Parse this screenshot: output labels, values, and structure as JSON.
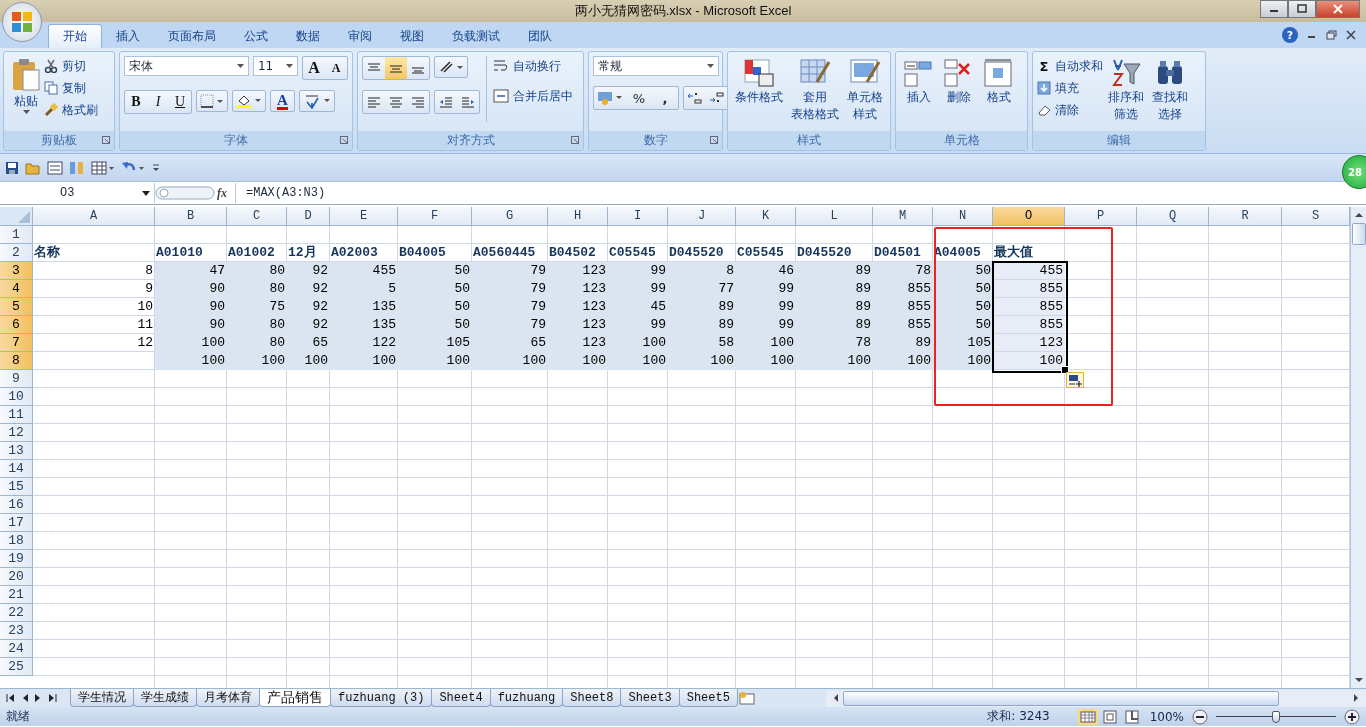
{
  "window": {
    "title": "两小无猜网密码.xlsx - Microsoft Excel"
  },
  "ribbon": {
    "tabs": [
      {
        "label": "开始",
        "selected": true
      },
      {
        "label": "插入",
        "selected": false
      },
      {
        "label": "页面布局",
        "selected": false
      },
      {
        "label": "公式",
        "selected": false
      },
      {
        "label": "数据",
        "selected": false
      },
      {
        "label": "审阅",
        "selected": false
      },
      {
        "label": "视图",
        "selected": false
      },
      {
        "label": "负载测试",
        "selected": false
      },
      {
        "label": "团队",
        "selected": false
      }
    ],
    "help": "?",
    "clipboard": {
      "paste": "粘贴",
      "cut": "剪切",
      "copy": "复制",
      "format_painter": "格式刷",
      "title": "剪贴板"
    },
    "font": {
      "name": "宋体",
      "size": "11",
      "grow": "A",
      "shrink": "A",
      "bold": "B",
      "italic": "I",
      "underline": "U",
      "font_color": "A",
      "title": "字体"
    },
    "alignment": {
      "wrap": "自动换行",
      "merge": "合并后居中",
      "title": "对齐方式"
    },
    "number": {
      "format": "常规",
      "percent": "%",
      "comma": ",",
      "title": "数字"
    },
    "styles": {
      "conditional": "条件格式",
      "table": [
        "套用",
        "表格格式"
      ],
      "cell": [
        "单元格",
        "样式"
      ],
      "title": "样式"
    },
    "cells": {
      "insert": "插入",
      "delete": "删除",
      "format": "格式",
      "title": "单元格"
    },
    "editing": {
      "autosum_icon": "Σ",
      "autosum": "自动求和",
      "fill": "填充",
      "clear": "清除",
      "sort": [
        "排序和",
        "筛选"
      ],
      "find": [
        "查找和",
        "选择"
      ],
      "title": "编辑"
    }
  },
  "badge": "28",
  "formula_bar": {
    "name_box": "O3",
    "function_icon": "fx",
    "formula": "=MAX(A3:N3)"
  },
  "grid": {
    "columns": [
      {
        "label": "A",
        "selected": false
      },
      {
        "label": "B",
        "selected": false,
        "shaded": true
      },
      {
        "label": "C",
        "selected": false,
        "shaded": true
      },
      {
        "label": "D",
        "selected": false,
        "shaded": true
      },
      {
        "label": "E",
        "selected": false,
        "shaded": true
      },
      {
        "label": "F",
        "selected": false,
        "shaded": true
      },
      {
        "label": "G",
        "selected": false,
        "shaded": true
      },
      {
        "label": "H",
        "selected": false,
        "shaded": true
      },
      {
        "label": "I",
        "selected": false,
        "shaded": true
      },
      {
        "label": "J",
        "selected": false,
        "shaded": true
      },
      {
        "label": "K",
        "selected": false,
        "shaded": true
      },
      {
        "label": "L",
        "selected": false,
        "shaded": true
      },
      {
        "label": "M",
        "selected": false,
        "shaded": true
      },
      {
        "label": "N",
        "selected": false,
        "shaded": true
      },
      {
        "label": "O",
        "selected": true
      },
      {
        "label": "P",
        "selected": false
      },
      {
        "label": "Q",
        "selected": false
      },
      {
        "label": "R",
        "selected": false
      },
      {
        "label": "S",
        "selected": false
      }
    ],
    "rows": [
      {
        "number": "1",
        "selected": false
      },
      {
        "number": "2",
        "selected": false,
        "kind": "header",
        "cells": [
          "名称",
          "A01010",
          "A01002",
          "12月",
          "A02003",
          "B04005",
          "A0560445",
          "B04502",
          "C05545",
          "D045520",
          "C05545",
          "D045520",
          "D04501",
          "A04005",
          "最大值"
        ]
      },
      {
        "number": "3",
        "selected": true,
        "shaded": true,
        "cells": [
          "8",
          "47",
          "80",
          "92",
          "455",
          "50",
          "79",
          "123",
          "99",
          "8",
          "46",
          "89",
          "78",
          "50",
          "455"
        ]
      },
      {
        "number": "4",
        "selected": true,
        "shaded": true,
        "cells": [
          "9",
          "90",
          "80",
          "92",
          "5",
          "50",
          "79",
          "123",
          "99",
          "77",
          "99",
          "89",
          "855",
          "50",
          "855"
        ]
      },
      {
        "number": "5",
        "selected": true,
        "shaded": true,
        "cells": [
          "10",
          "90",
          "75",
          "92",
          "135",
          "50",
          "79",
          "123",
          "45",
          "89",
          "99",
          "89",
          "855",
          "50",
          "855"
        ]
      },
      {
        "number": "6",
        "selected": true,
        "shaded": true,
        "cells": [
          "11",
          "90",
          "80",
          "92",
          "135",
          "50",
          "79",
          "123",
          "99",
          "89",
          "99",
          "89",
          "855",
          "50",
          "855"
        ]
      },
      {
        "number": "7",
        "selected": true,
        "shaded": true,
        "cells": [
          "12",
          "100",
          "80",
          "65",
          "122",
          "105",
          "65",
          "123",
          "100",
          "58",
          "100",
          "78",
          "89",
          "105",
          "123"
        ]
      },
      {
        "number": "8",
        "selected": true,
        "shaded": true,
        "cells": [
          null,
          "100",
          "100",
          "100",
          "100",
          "100",
          "100",
          "100",
          "100",
          "100",
          "100",
          "100",
          "100",
          "100",
          "100"
        ]
      },
      {
        "number": "9",
        "selected": false
      },
      {
        "number": "10",
        "selected": false
      },
      {
        "number": "11",
        "selected": false
      },
      {
        "number": "12",
        "selected": false
      },
      {
        "number": "13",
        "selected": false
      },
      {
        "number": "14",
        "selected": false
      },
      {
        "number": "15",
        "selected": false
      },
      {
        "number": "16",
        "selected": false
      },
      {
        "number": "17",
        "selected": false
      },
      {
        "number": "18",
        "selected": false
      },
      {
        "number": "19",
        "selected": false
      },
      {
        "number": "20",
        "selected": false
      },
      {
        "number": "21",
        "selected": false
      },
      {
        "number": "22",
        "selected": false
      },
      {
        "number": "23",
        "selected": false
      },
      {
        "number": "24",
        "selected": false
      },
      {
        "number": "25",
        "selected": false
      }
    ],
    "annotation": {
      "kind": "rectangle"
    }
  },
  "sheet_tabs": [
    {
      "label": "学生情况",
      "selected": false
    },
    {
      "label": "学生成绩",
      "selected": false
    },
    {
      "label": "月考体育",
      "selected": false
    },
    {
      "label": "产品销售",
      "selected": true
    },
    {
      "label": "fuzhuang (3)",
      "selected": false
    },
    {
      "label": "Sheet4",
      "selected": false
    },
    {
      "label": "fuzhuang",
      "selected": false
    },
    {
      "label": "Sheet8",
      "selected": false
    },
    {
      "label": "Sheet3",
      "selected": false
    },
    {
      "label": "Sheet5",
      "selected": false
    }
  ],
  "status_bar": {
    "state": "就绪",
    "sum": "求和: 3243",
    "zoom": "100%",
    "zoom_slider": {
      "level": 0.5
    }
  }
}
